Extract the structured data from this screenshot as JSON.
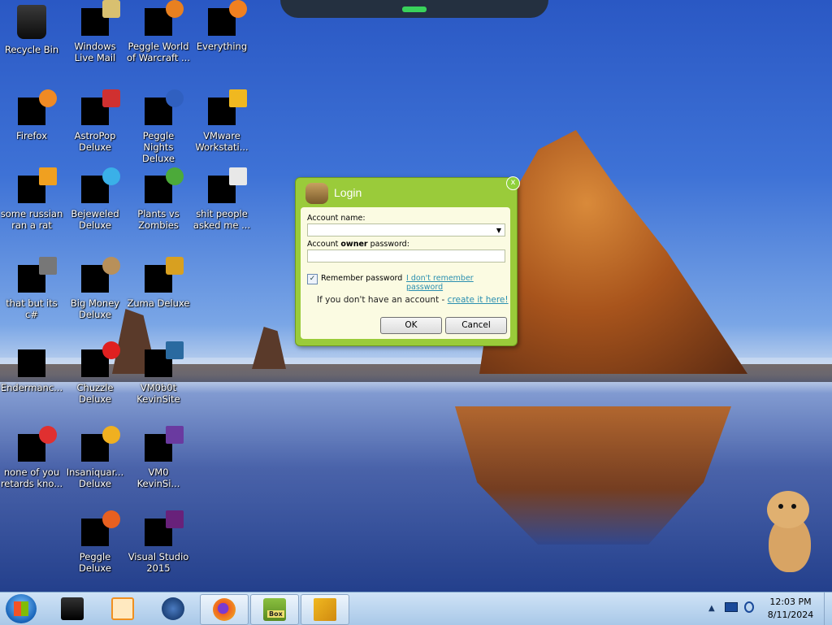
{
  "desktop": {
    "icons": [
      {
        "label": "Recycle Bin"
      },
      {
        "label": "Windows Live Mail"
      },
      {
        "label": "Peggle World of Warcraft ..."
      },
      {
        "label": "Everything"
      },
      {
        "label": "Firefox"
      },
      {
        "label": "AstroPop Deluxe"
      },
      {
        "label": "Peggle Nights Deluxe"
      },
      {
        "label": "VMware Workstati..."
      },
      {
        "label": "some russian ran a rat"
      },
      {
        "label": "Bejeweled Deluxe"
      },
      {
        "label": "Plants vs Zombies"
      },
      {
        "label": "shit people asked me ..."
      },
      {
        "label": "that but its c#"
      },
      {
        "label": "Big Money Deluxe"
      },
      {
        "label": "Zuma Deluxe"
      },
      {
        "label": "Endermanc..."
      },
      {
        "label": "Chuzzle Deluxe"
      },
      {
        "label": "VM0b0t KevinSite"
      },
      {
        "label": "none of you retards kno..."
      },
      {
        "label": "Insaniquar... Deluxe"
      },
      {
        "label": "VM0 KevinSi..."
      },
      {
        "label": "Peggle Deluxe"
      },
      {
        "label": "Visual Studio 2015"
      }
    ]
  },
  "login_dialog": {
    "title": "Login",
    "close_glyph": "x",
    "account_name_label": "Account name:",
    "password_label_prefix": "Account ",
    "password_label_bold": "owner",
    "password_label_suffix": " password:",
    "account_name_value": "",
    "password_value": "",
    "remember_label": "Remember password",
    "remember_checked": true,
    "forgot_link": "I don't remember password",
    "signup_prefix": "If you don't have an account - ",
    "signup_link": "create it here!",
    "ok_button": "OK",
    "cancel_button": "Cancel"
  },
  "taskbar": {
    "items": [
      {
        "icon": "terminal-icon"
      },
      {
        "icon": "media-player-icon"
      },
      {
        "icon": "globe-icon"
      },
      {
        "icon": "firefox-icon"
      },
      {
        "icon": "hamster-box-icon",
        "label": "Box"
      },
      {
        "icon": "vmware-icon"
      }
    ],
    "tray": {
      "show_hidden_glyph": "▲",
      "time": "12:03 PM",
      "date": "8/11/2024"
    }
  },
  "colors": {
    "dialog_green": "#9acb3a",
    "link_teal": "#2a8fb0",
    "taskbar_blue": "#bcd5ef"
  }
}
